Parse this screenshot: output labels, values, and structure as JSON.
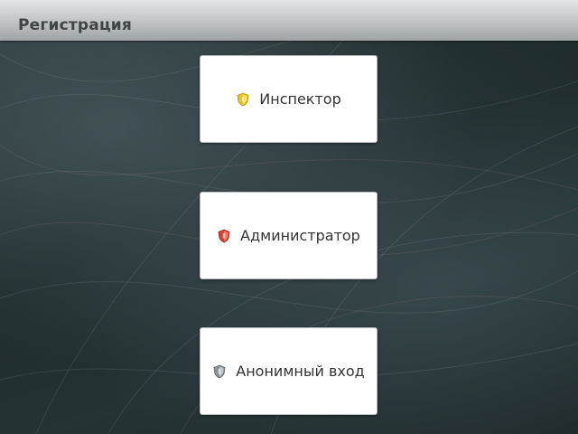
{
  "header": {
    "title": "Регистрация"
  },
  "roles": [
    {
      "label": "Инспектор",
      "icon": "shield-yellow-icon",
      "icon_color": "#e8c21c"
    },
    {
      "label": "Администратор",
      "icon": "shield-red-icon",
      "icon_color": "#d9402f"
    },
    {
      "label": "Анонимный вход",
      "icon": "shield-gray-icon",
      "icon_color": "#8e9294"
    }
  ]
}
